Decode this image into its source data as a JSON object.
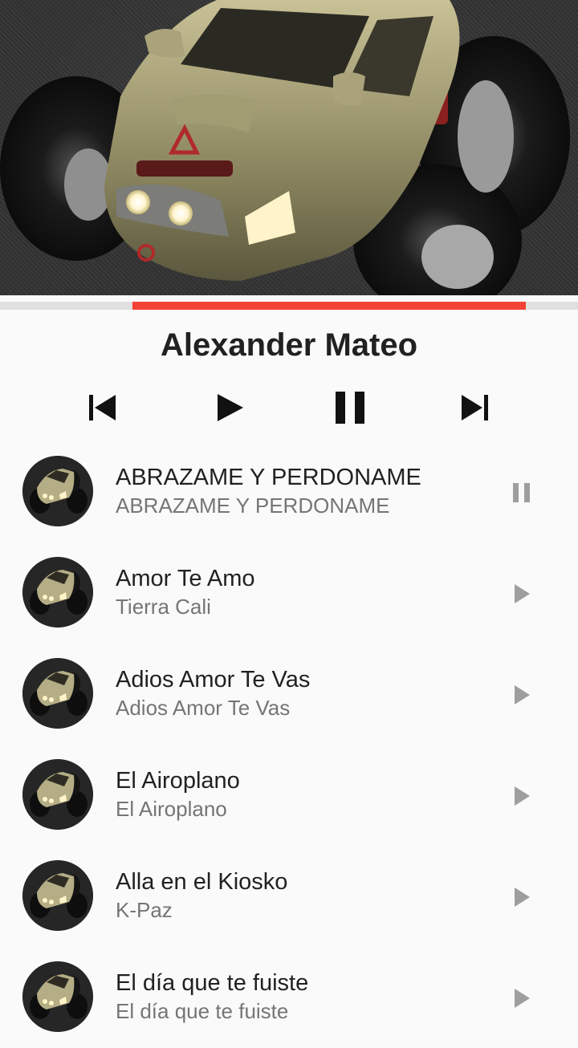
{
  "now_playing": {
    "artist": "Alexander Mateo",
    "progress": 0.68,
    "artwork_icon": "monster-truck-artwork"
  },
  "colors": {
    "accent": "#f44336",
    "track_bg": "#e0e0e0",
    "title": "#212121",
    "subtitle": "#757575",
    "row_icon": "#9e9e9e"
  },
  "controls": {
    "previous_icon": "skip-previous-icon",
    "play_icon": "play-icon",
    "pause_icon": "pause-icon",
    "next_icon": "skip-next-icon"
  },
  "tracks": [
    {
      "title": "ABRAZAME Y PERDONAME",
      "artist": "ABRAZAME Y PERDONAME",
      "action_icon": "pause-icon"
    },
    {
      "title": "Amor Te Amo",
      "artist": "Tierra Cali",
      "action_icon": "play-icon"
    },
    {
      "title": "Adios Amor Te Vas",
      "artist": "Adios Amor Te Vas",
      "action_icon": "play-icon"
    },
    {
      "title": "El Airoplano",
      "artist": "El Airoplano",
      "action_icon": "play-icon"
    },
    {
      "title": "Alla en el Kiosko",
      "artist": "K-Paz",
      "action_icon": "play-icon"
    },
    {
      "title": "El día que te fuiste",
      "artist": "El día que te fuiste",
      "action_icon": "play-icon"
    }
  ]
}
